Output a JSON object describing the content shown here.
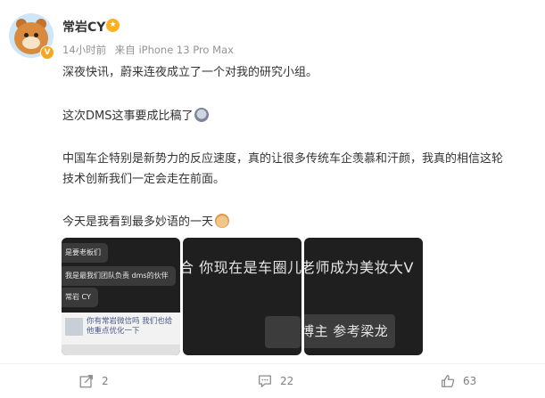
{
  "author": {
    "name": "常岩CY",
    "verified_mark": "V"
  },
  "meta": {
    "time": "14小时前",
    "source": "来自 iPhone 13 Pro Max"
  },
  "post": {
    "lines": [
      "深夜快讯，蔚来连夜成立了一个对我的研究小组。",
      "这次DMS这事要成比稿了",
      "中国车企特别是新势力的反应速度，真的让很多传统车企羡慕和汗颜，我真的相信这轮",
      "技术创新我们一定会走在前面。",
      "今天是我看到最多妙语的一天"
    ]
  },
  "images": {
    "img1": {
      "msgs": [
        "是要老板们",
        "我是最我们团队负责 dms的伙伴",
        "常岩 CY"
      ],
      "card_text": "你有常岩微信吗 我们也给他重点优化一下"
    },
    "img2": {
      "text": "合 你现在是车圈儿才"
    },
    "img3": {
      "text_top": "老师成为美妆大V",
      "text_bottom": "博主 参考梁龙"
    }
  },
  "actions": {
    "repost_count": "2",
    "comment_count": "22",
    "like_count": "63"
  },
  "icons": [
    "repost-icon",
    "comment-icon",
    "like-icon",
    "member-badge-icon",
    "verified-badge-icon"
  ],
  "colors": {
    "accent": "#f5a623",
    "text": "#333333",
    "meta": "#939393"
  }
}
